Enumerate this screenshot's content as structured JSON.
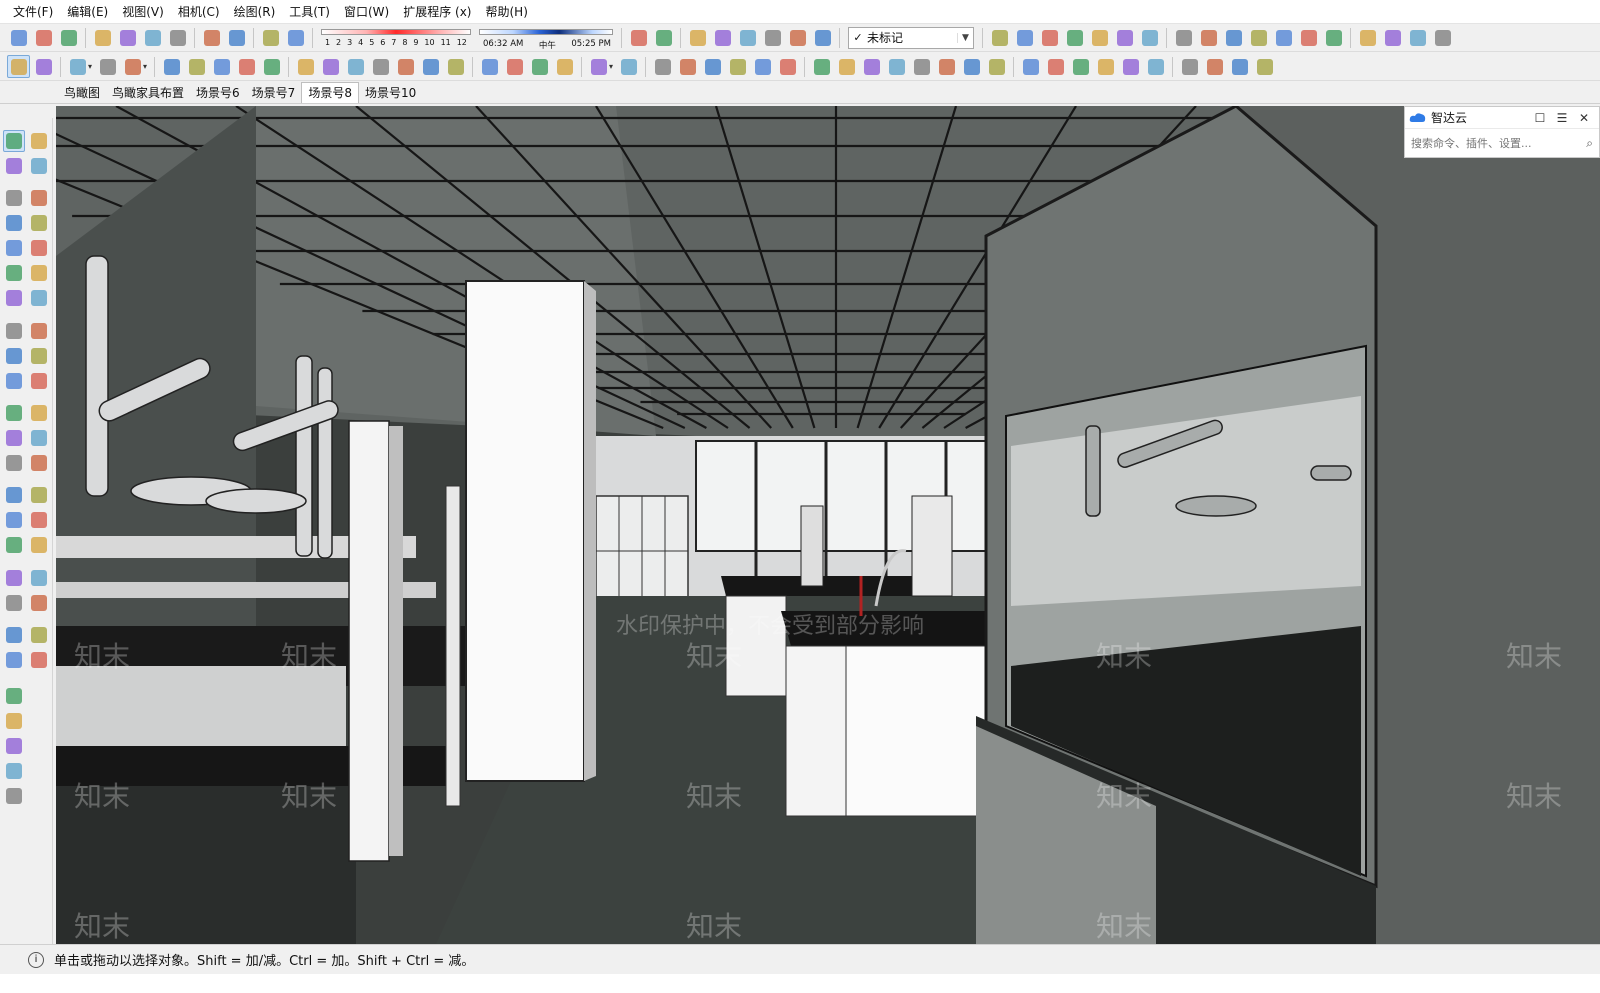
{
  "menu": [
    "文件(F)",
    "编辑(E)",
    "视图(V)",
    "相机(C)",
    "绘图(R)",
    "工具(T)",
    "窗口(W)",
    "扩展程序 (x)",
    "帮助(H)"
  ],
  "shadow": {
    "months": [
      "1",
      "2",
      "3",
      "4",
      "5",
      "6",
      "7",
      "8",
      "9",
      "10",
      "11",
      "12"
    ],
    "time_start": "06:32 AM",
    "time_mid": "中午",
    "time_end": "05:25 PM"
  },
  "tag_select": {
    "check": "✓",
    "value": "未标记"
  },
  "scenes": [
    {
      "label": "鸟瞰图",
      "active": false
    },
    {
      "label": "鸟瞰家具布置",
      "active": false
    },
    {
      "label": "场景号6",
      "active": false
    },
    {
      "label": "场景号7",
      "active": false
    },
    {
      "label": "场景号8",
      "active": true
    },
    {
      "label": "场景号10",
      "active": false
    }
  ],
  "side_panel": {
    "title": "智达云",
    "search_placeholder": "搜索命令、插件、设置..."
  },
  "watermark": {
    "brand": "知末",
    "notice": "水印保护中，不会受到部分影响"
  },
  "status": {
    "icon": "i",
    "text": "单击或拖动以选择对象。Shift = 加/减。Ctrl = 加。Shift + Ctrl = 减。"
  },
  "icons": {
    "toolbar1": [
      "new-file-icon",
      "open-file-icon",
      "save-icon",
      "cut-icon",
      "copy-icon",
      "paste-icon",
      "erase-icon",
      "undo-icon",
      "redo-icon",
      "print-icon",
      "model-info-icon",
      "eraser-tool-icon",
      "shadow-settings-icon",
      "layer-icon",
      "component-icon",
      "component-icon",
      "component-icon",
      "component-icon",
      "component-icon",
      "tag-icon",
      "iso-view-icon",
      "top-view-icon",
      "front-view-icon",
      "right-view-icon",
      "back-view-icon",
      "left-view-icon",
      "xray-icon",
      "wireframe-icon",
      "hidden-line-icon",
      "shaded-icon",
      "textured-icon",
      "monochrome-icon",
      "style-icon",
      "section-icon",
      "section-cut-icon",
      "section-fill-icon",
      "section-display-icon"
    ],
    "toolbar2": [
      "select-icon",
      "eraser-icon",
      "pencil-icon",
      "arc-icon",
      "circle-icon",
      "pushpull-icon",
      "followme-icon",
      "move-icon",
      "rotate-icon",
      "scale-icon",
      "tape-icon",
      "text-icon",
      "paint-icon",
      "orbit-icon",
      "pan-icon",
      "zoom-icon",
      "zoom-extents-icon",
      "sandbox-icon",
      "sandbox-icon",
      "sandbox-icon",
      "sandbox-icon",
      "user-icon",
      "solid-tools-icon",
      "outer-shell-icon",
      "intersect-icon",
      "union-icon",
      "subtract-icon",
      "trim-icon",
      "split-icon",
      "warehouse-icon",
      "geo-icon",
      "lamp-icon",
      "light-icon",
      "spotlight-icon",
      "sun-icon",
      "dome-icon",
      "sphere-icon",
      "render-icon",
      "render-icon",
      "render-icon",
      "render-icon",
      "render-icon",
      "render-icon",
      "window-icon",
      "window-icon",
      "window-icon",
      "window-icon"
    ],
    "left": [
      "select-icon",
      "component-icon",
      "paint-icon",
      "eraser-icon",
      "line-icon",
      "freehand-icon",
      "rectangle-icon",
      "rotated-rect-icon",
      "circle-icon",
      "polygon-icon",
      "arc-icon",
      "pie-icon",
      "arc3-icon",
      "arc2-icon",
      "move-icon",
      "pushpull-icon",
      "rotate-icon",
      "followme-icon",
      "scale-icon",
      "offset-icon",
      "tape-icon",
      "dimension-icon",
      "protractor-icon",
      "text-icon",
      "axes-icon",
      "3dtext-icon",
      "orbit-icon",
      "pan-icon",
      "zoom-icon",
      "zoom-window-icon",
      "zoom-extents-icon",
      "previous-view-icon",
      "position-camera-icon",
      "lookaround-icon",
      "walk-icon",
      "section-plane-icon",
      "sandbox-scratch-icon",
      "sandbox-contours-icon",
      "sandbox-smoove-icon",
      "sandbox-stamp-icon",
      "section-icon",
      "solid-icon",
      "solid-icon",
      "solid-icon",
      "solid-icon"
    ]
  }
}
